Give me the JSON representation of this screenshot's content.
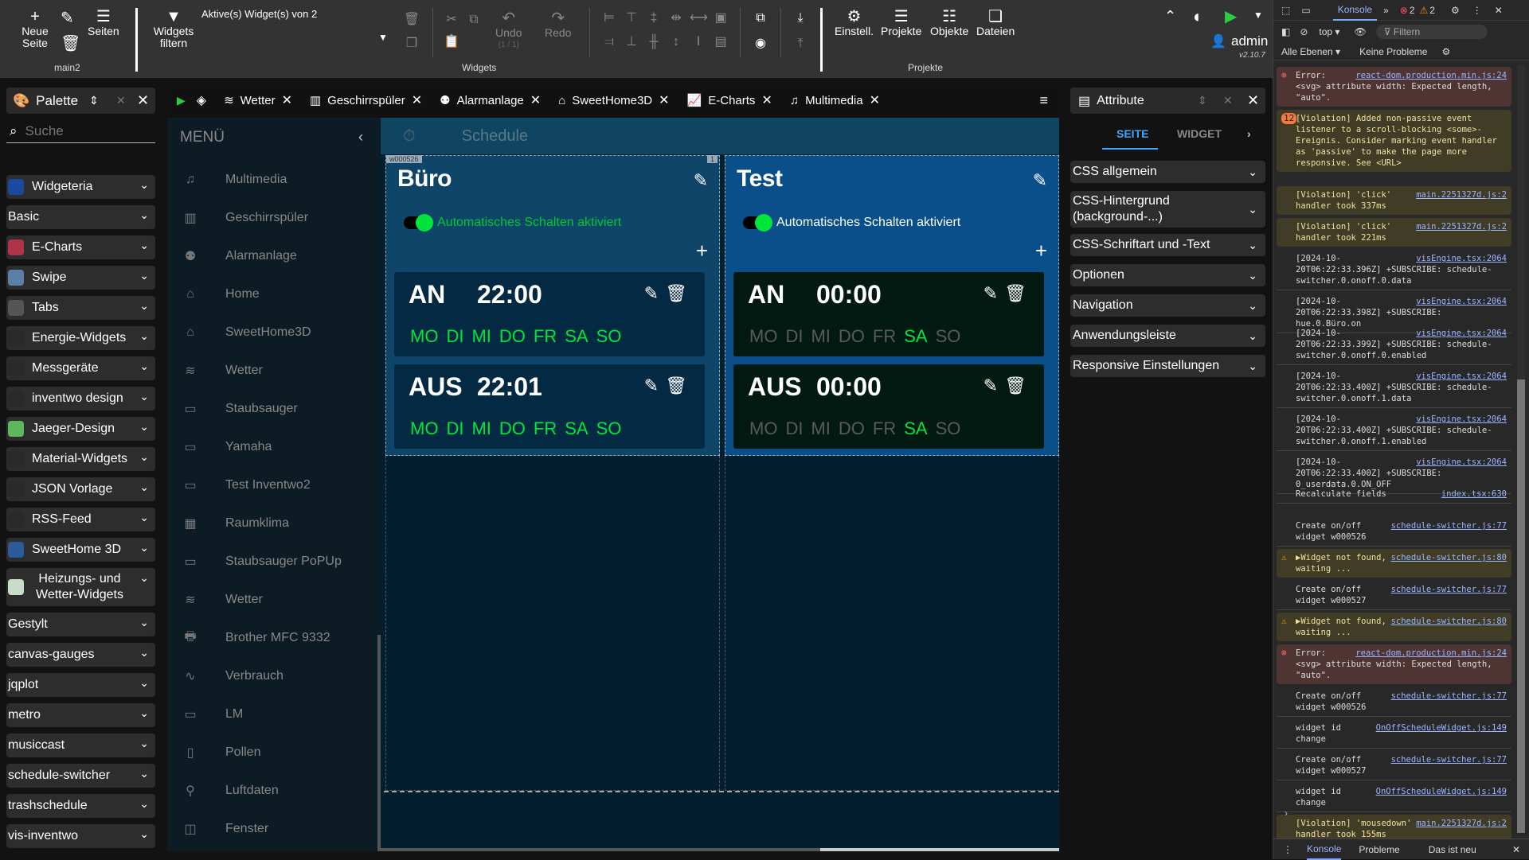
{
  "toolbar": {
    "new_page": "Neue Seite",
    "pages": "Seiten",
    "page_name": "main2",
    "filter_widgets": "Widgets filtern",
    "active_widgets": "Aktive(s) Widget(s) von 2",
    "undo": "Undo",
    "undo_count": "(1 / 1)",
    "redo": "Redo",
    "widgets_section": "Widgets",
    "settings": "Einstell.",
    "projects": "Projekte",
    "objects": "Objekte",
    "files": "Dateien",
    "projects_section": "Projekte",
    "user": "admin",
    "version": "v2.10.7"
  },
  "palette": {
    "title": "Palette",
    "search_placeholder": "Suche",
    "items": [
      {
        "label": "Widgeteria",
        "color": "#1a4aa0"
      },
      {
        "label": "Basic",
        "color": ""
      },
      {
        "label": "E-Charts",
        "color": "#b0334a"
      },
      {
        "label": "Swipe",
        "color": "#5c7fa8"
      },
      {
        "label": "Tabs",
        "color": "#555"
      },
      {
        "label": "Energie-Widgets",
        "color": "#2a2a2a"
      },
      {
        "label": "Messgeräte",
        "color": "#2a2a2a"
      },
      {
        "label": "inventwo design",
        "color": "#2a2a2a"
      },
      {
        "label": "Jaeger-Design",
        "color": "#5cb85c"
      },
      {
        "label": "Material-Widgets",
        "color": "#2a2a2a"
      },
      {
        "label": "JSON Vorlage",
        "color": "#2a2a2a"
      },
      {
        "label": "RSS-Feed",
        "color": "#2a2a2a"
      },
      {
        "label": "SweetHome 3D",
        "color": "#2a5a9a"
      },
      {
        "label": "Heizungs- und Wetter-Widgets",
        "color": "#c8dcc8"
      },
      {
        "label": "Gestylt",
        "color": ""
      },
      {
        "label": "canvas-gauges",
        "color": ""
      },
      {
        "label": "jqplot",
        "color": ""
      },
      {
        "label": "metro",
        "color": ""
      },
      {
        "label": "musiccast",
        "color": ""
      },
      {
        "label": "schedule-switcher",
        "color": ""
      },
      {
        "label": "trashschedule",
        "color": ""
      },
      {
        "label": "vis-inventwo",
        "color": ""
      }
    ]
  },
  "tabs": [
    {
      "label": "Wetter",
      "icon": "weather-icon"
    },
    {
      "label": "Geschirrspüler",
      "icon": "dishwasher-icon"
    },
    {
      "label": "Alarmanlage",
      "icon": "alarm-icon"
    },
    {
      "label": "SweetHome3D",
      "icon": "home-icon"
    },
    {
      "label": "E-Charts",
      "icon": "chart-icon"
    },
    {
      "label": "Multimedia",
      "icon": "music-icon"
    }
  ],
  "menu": {
    "title": "MENÜ",
    "items": [
      "Multimedia",
      "Geschirrspüler",
      "Alarmanlage",
      "Home",
      "SweetHome3D",
      "Wetter",
      "Staubsauger",
      "Yamaha",
      "Test Inventwo2",
      "Raumklima",
      "Staubsauger PoPUp",
      "Wetter",
      "Brother MFC 9332",
      "Verbrauch",
      "LM",
      "Pollen",
      "Luftdaten",
      "Fenster"
    ]
  },
  "canvas": {
    "header_title": "Schedule",
    "widget_id_badge": "w000526",
    "widget_badge_right": "1",
    "widgets": [
      {
        "title": "Büro",
        "toggle_label": "Automatisches Schalten aktiviert",
        "toggle_on": true,
        "entries": [
          {
            "type": "AN",
            "time": "22:00",
            "days": [
              [
                "MO",
                true
              ],
              [
                "DI",
                true
              ],
              [
                "MI",
                true
              ],
              [
                "DO",
                true
              ],
              [
                "FR",
                true
              ],
              [
                "SA",
                true
              ],
              [
                "SO",
                true
              ]
            ]
          },
          {
            "type": "AUS",
            "time": "22:01",
            "days": [
              [
                "MO",
                true
              ],
              [
                "DI",
                true
              ],
              [
                "MI",
                true
              ],
              [
                "DO",
                true
              ],
              [
                "FR",
                true
              ],
              [
                "SA",
                true
              ],
              [
                "SO",
                true
              ]
            ]
          }
        ]
      },
      {
        "title": "Test",
        "toggle_label": "Automatisches Schalten aktiviert",
        "toggle_on": true,
        "entries": [
          {
            "type": "AN",
            "time": "00:00",
            "days": [
              [
                "MO",
                false
              ],
              [
                "DI",
                false
              ],
              [
                "MI",
                false
              ],
              [
                "DO",
                false
              ],
              [
                "FR",
                false
              ],
              [
                "SA",
                true
              ],
              [
                "SO",
                false
              ]
            ]
          },
          {
            "type": "AUS",
            "time": "00:00",
            "days": [
              [
                "MO",
                false
              ],
              [
                "DI",
                false
              ],
              [
                "MI",
                false
              ],
              [
                "DO",
                false
              ],
              [
                "FR",
                false
              ],
              [
                "SA",
                true
              ],
              [
                "SO",
                false
              ]
            ]
          }
        ]
      }
    ]
  },
  "attributes": {
    "title": "Attribute",
    "tab_page": "SEITE",
    "tab_widget": "WIDGET",
    "sections": [
      "CSS allgemein",
      "CSS-Hintergrund (background-...)",
      "CSS-Schriftart und -Text",
      "Optionen",
      "Navigation",
      "Anwendungsleiste",
      "Responsive Einstellungen"
    ]
  },
  "devtools": {
    "tab_console": "Konsole",
    "errors": "2",
    "warnings": "2",
    "context": "top",
    "filter_placeholder": "Filtern",
    "levels": "Alle Ebenen",
    "issues": "Keine Probleme",
    "logs": [
      {
        "kind": "err",
        "src": "react-dom.production.min.js:24",
        "text": "Error: <svg> attribute width: Expected length, \"auto\"."
      },
      {
        "kind": "warn",
        "badge": "12",
        "src": "",
        "text": "[Violation] Added non-passive event listener to a scroll-blocking <some>-Ereignis. Consider marking event handler as 'passive' to make the page more responsive. See <URL>"
      },
      {
        "kind": "warn",
        "src": "main.2251327d.js:2",
        "text": "[Violation] 'click' handler took 337ms"
      },
      {
        "kind": "warn",
        "src": "main.2251327d.js:2",
        "text": "[Violation] 'click' handler took 221ms"
      },
      {
        "kind": "plain",
        "src": "visEngine.tsx:2064",
        "text": "[2024-10-20T06:22:33.396Z] +SUBSCRIBE: schedule-switcher.0.onoff.0.data"
      },
      {
        "kind": "plain",
        "src": "visEngine.tsx:2064",
        "text": "[2024-10-20T06:22:33.398Z] +SUBSCRIBE: hue.0.Büro.on"
      },
      {
        "kind": "plain",
        "src": "visEngine.tsx:2064",
        "text": "[2024-10-20T06:22:33.399Z] +SUBSCRIBE: schedule-switcher.0.onoff.0.enabled"
      },
      {
        "kind": "plain",
        "src": "visEngine.tsx:2064",
        "text": "[2024-10-20T06:22:33.400Z] +SUBSCRIBE: schedule-switcher.0.onoff.1.data"
      },
      {
        "kind": "plain",
        "src": "visEngine.tsx:2064",
        "text": "[2024-10-20T06:22:33.400Z] +SUBSCRIBE: schedule-switcher.0.onoff.1.enabled"
      },
      {
        "kind": "plain",
        "src": "visEngine.tsx:2064",
        "text": "[2024-10-20T06:22:33.400Z] +SUBSCRIBE: 0_userdata.0.ON_OFF"
      },
      {
        "kind": "plain",
        "src": "index.tsx:630",
        "text": "Recalculate fields"
      },
      {
        "kind": "plain",
        "src": "schedule-switcher.js:77",
        "text": "Create on/off widget w000526"
      },
      {
        "kind": "warn",
        "src": "schedule-switcher.js:80",
        "text": "▶Widget not found, waiting ..."
      },
      {
        "kind": "plain",
        "src": "schedule-switcher.js:77",
        "text": "Create on/off widget w000527"
      },
      {
        "kind": "warn",
        "src": "schedule-switcher.js:80",
        "text": "▶Widget not found, waiting ..."
      },
      {
        "kind": "err",
        "src": "react-dom.production.min.js:24",
        "text": "Error: <svg> attribute width: Expected length, \"auto\"."
      },
      {
        "kind": "plain",
        "src": "schedule-switcher.js:77",
        "text": "Create on/off widget w000526"
      },
      {
        "kind": "plain",
        "src": "OnOffScheduleWidget.js:149",
        "text": "widget id change"
      },
      {
        "kind": "plain",
        "src": "schedule-switcher.js:77",
        "text": "Create on/off widget w000527"
      },
      {
        "kind": "plain",
        "src": "OnOffScheduleWidget.js:149",
        "text": "widget id change"
      },
      {
        "kind": "warn",
        "src": "main.2251327d.js:2",
        "text": "[Violation] 'mousedown' handler took 155ms"
      }
    ],
    "bottom_tabs": [
      "Konsole",
      "Probleme",
      "Das ist neu"
    ]
  },
  "colors": {
    "accent": "#3ea6ff",
    "active_green": "#00e53a",
    "canvas_bg": "#021e2f"
  }
}
